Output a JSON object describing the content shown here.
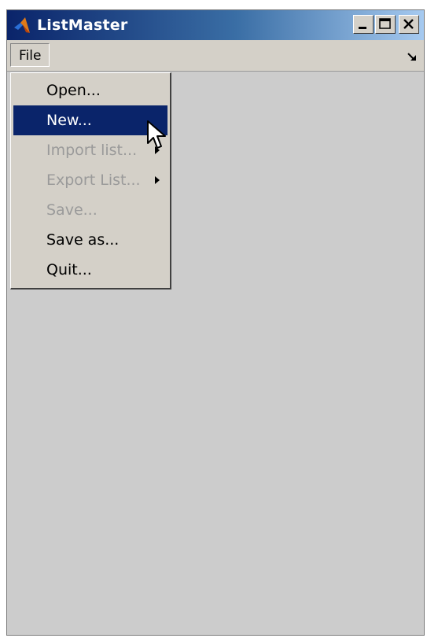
{
  "window": {
    "title": "ListMaster",
    "title_buttons": {
      "minimize": "minimize-icon",
      "maximize": "maximize-icon",
      "close": "close-icon"
    },
    "colors": {
      "titlebar_start": "#0a246a",
      "titlebar_end": "#a6caf0",
      "selection": "#0a246a",
      "canvas": "#cccccc"
    }
  },
  "menubar": {
    "file_label": "File",
    "dock_icon": "dock-arrow-icon"
  },
  "file_menu": {
    "items": [
      {
        "label": "Open...",
        "enabled": true,
        "submenu": false
      },
      {
        "label": "New...",
        "enabled": true,
        "submenu": false,
        "selected": true
      },
      {
        "label": "Import list...",
        "enabled": false,
        "submenu": true
      },
      {
        "label": "Export List...",
        "enabled": false,
        "submenu": true
      },
      {
        "label": "Save...",
        "enabled": false,
        "submenu": false
      },
      {
        "label": "Save as...",
        "enabled": true,
        "submenu": false
      },
      {
        "label": "Quit...",
        "enabled": true,
        "submenu": false
      }
    ]
  }
}
